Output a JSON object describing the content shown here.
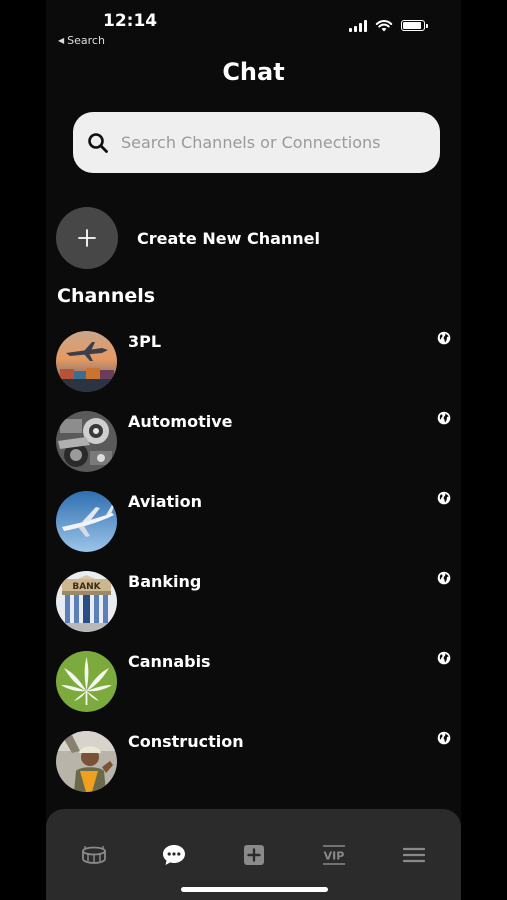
{
  "status_bar": {
    "time": "12:14",
    "back_label": "Search"
  },
  "header": {
    "title": "Chat"
  },
  "search": {
    "placeholder": "Search Channels or Connections"
  },
  "create": {
    "label": "Create New Channel"
  },
  "channels_section": {
    "title": "Channels",
    "items": [
      {
        "name": "3PL",
        "image": "cargo-plane-port-photo"
      },
      {
        "name": "Automotive",
        "image": "engine-photo"
      },
      {
        "name": "Aviation",
        "image": "airplane-sky-photo"
      },
      {
        "name": "Banking",
        "image": "bank-building-photo"
      },
      {
        "name": "Cannabis",
        "image": "cannabis-leaf-photo"
      },
      {
        "name": "Construction",
        "image": "construction-worker-photo"
      }
    ]
  },
  "tabbar": {
    "items": [
      {
        "icon": "stadium-icon",
        "active": false
      },
      {
        "icon": "chat-bubble-icon",
        "active": true
      },
      {
        "icon": "plus-square-icon",
        "active": false
      },
      {
        "icon": "vip-icon",
        "label": "VIP",
        "active": false
      },
      {
        "icon": "menu-icon",
        "active": false
      }
    ]
  },
  "colors": {
    "background": "#0b0b0b",
    "search_bg": "#efefef",
    "create_button_bg": "#474747",
    "tabbar_bg": "#2b2b2b",
    "active_tab": "#ffffff",
    "inactive_tab": "#8a8a8a"
  }
}
